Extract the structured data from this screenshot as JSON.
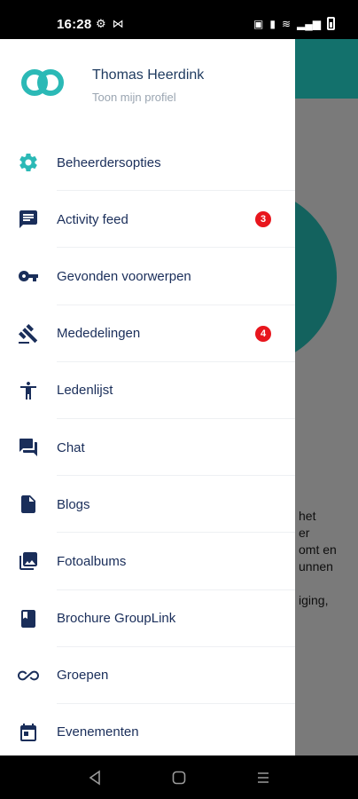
{
  "status_bar": {
    "time": "16:28",
    "left_icons": [
      "gear-icon",
      "hourglass-icon"
    ],
    "right_icons": [
      "nfc-icon",
      "vibrate-icon",
      "wifi-icon",
      "signal-icon",
      "battery-icon"
    ]
  },
  "profile": {
    "name": "Thomas Heerdink",
    "subtitle": "Toon mijn profiel"
  },
  "colors": {
    "accent": "#2bb9b6",
    "icon": "#1a2e5a",
    "badge": "#e8161d",
    "header": "#13716c"
  },
  "menu": {
    "items": [
      {
        "label": "Beheerdersopties",
        "icon": "gear-icon"
      },
      {
        "label": "Activity feed",
        "icon": "chat-bubble-icon",
        "badge": "3"
      },
      {
        "label": "Gevonden voorwerpen",
        "icon": "key-icon"
      },
      {
        "label": "Mededelingen",
        "icon": "gavel-icon",
        "badge": "4"
      },
      {
        "label": "Ledenlijst",
        "icon": "person-icon"
      },
      {
        "label": "Chat",
        "icon": "forum-icon"
      },
      {
        "label": "Blogs",
        "icon": "document-icon"
      },
      {
        "label": "Fotoalbums",
        "icon": "photo-library-icon"
      },
      {
        "label": "Brochure GroupLink",
        "icon": "book-icon"
      },
      {
        "label": "Groepen",
        "icon": "infinity-icon"
      },
      {
        "label": "Evenementen",
        "icon": "calendar-icon"
      }
    ]
  },
  "background": {
    "partial_text": "het\ner\nomt en\nunnen\n\niging,"
  },
  "nav_bar": {
    "buttons": [
      "back-icon",
      "home-icon",
      "recents-icon"
    ]
  }
}
